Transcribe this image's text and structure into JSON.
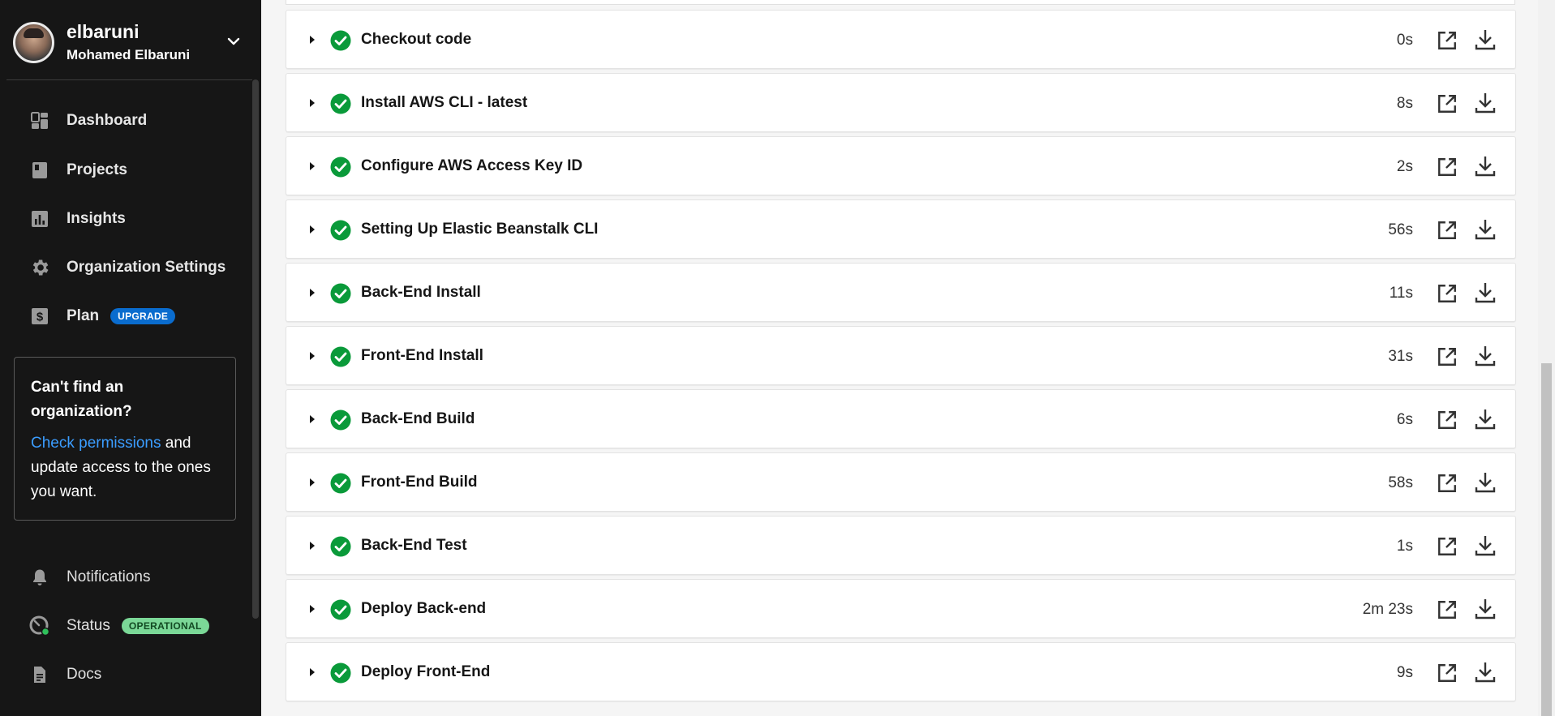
{
  "account": {
    "username": "elbaruni",
    "full_name": "Mohamed Elbaruni"
  },
  "nav": {
    "items": [
      {
        "label": "Dashboard",
        "icon": "dashboard-icon"
      },
      {
        "label": "Projects",
        "icon": "projects-icon"
      },
      {
        "label": "Insights",
        "icon": "insights-icon"
      },
      {
        "label": "Organization Settings",
        "icon": "gear-icon"
      },
      {
        "label": "Plan",
        "icon": "dollar-icon",
        "badge": "UPGRADE"
      }
    ]
  },
  "org_box": {
    "title": "Can't find an organization?",
    "link": "Check permissions",
    "text": " and update access to the ones you want."
  },
  "nav_bottom": {
    "notifications": "Notifications",
    "status": "Status",
    "status_badge": "OPERATIONAL",
    "docs": "Docs"
  },
  "steps": [
    {
      "name": "Checkout code",
      "duration": "0s",
      "status": "success"
    },
    {
      "name": "Install AWS CLI - latest",
      "duration": "8s",
      "status": "success"
    },
    {
      "name": "Configure AWS Access Key ID",
      "duration": "2s",
      "status": "success"
    },
    {
      "name": "Setting Up Elastic Beanstalk CLI",
      "duration": "56s",
      "status": "success"
    },
    {
      "name": "Back-End Install",
      "duration": "11s",
      "status": "success"
    },
    {
      "name": "Front-End Install",
      "duration": "31s",
      "status": "success"
    },
    {
      "name": "Back-End Build",
      "duration": "6s",
      "status": "success"
    },
    {
      "name": "Front-End Build",
      "duration": "58s",
      "status": "success"
    },
    {
      "name": "Back-End Test",
      "duration": "1s",
      "status": "success"
    },
    {
      "name": "Deploy Back-end",
      "duration": "2m 23s",
      "status": "success"
    },
    {
      "name": "Deploy Front-End",
      "duration": "9s",
      "status": "success"
    }
  ],
  "colors": {
    "sidebar_bg": "#161616",
    "success_green": "#0a9a3a",
    "link_blue": "#3b9dff",
    "upgrade_blue": "#0a6cce",
    "operational_green": "#7bd897"
  }
}
